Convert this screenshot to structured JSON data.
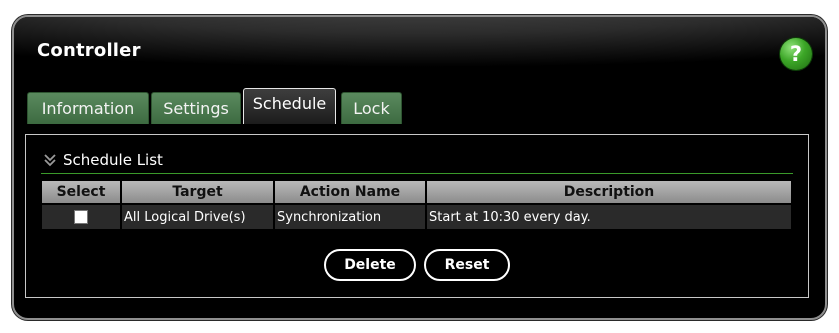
{
  "window": {
    "title": "Controller",
    "help_label": "?"
  },
  "tabs": [
    {
      "label": "Information",
      "active": false
    },
    {
      "label": "Settings",
      "active": false
    },
    {
      "label": "Schedule",
      "active": true
    },
    {
      "label": "Lock",
      "active": false
    }
  ],
  "section": {
    "title": "Schedule List",
    "icon": "double-chevron-down-icon"
  },
  "table": {
    "columns": [
      "Select",
      "Target",
      "Action Name",
      "Description"
    ],
    "rows": [
      {
        "selected": false,
        "target": "All Logical Drive(s)",
        "action_name": "Synchronization",
        "description": "Start at 10:30 every day."
      }
    ]
  },
  "buttons": {
    "delete_label": "Delete",
    "reset_label": "Reset"
  },
  "colors": {
    "background": "#000000",
    "tab_inactive": "#4a7a4e",
    "help_button": "#3ca627",
    "section_underline": "#3a9a2a",
    "table_header": "#a3a3a3"
  }
}
